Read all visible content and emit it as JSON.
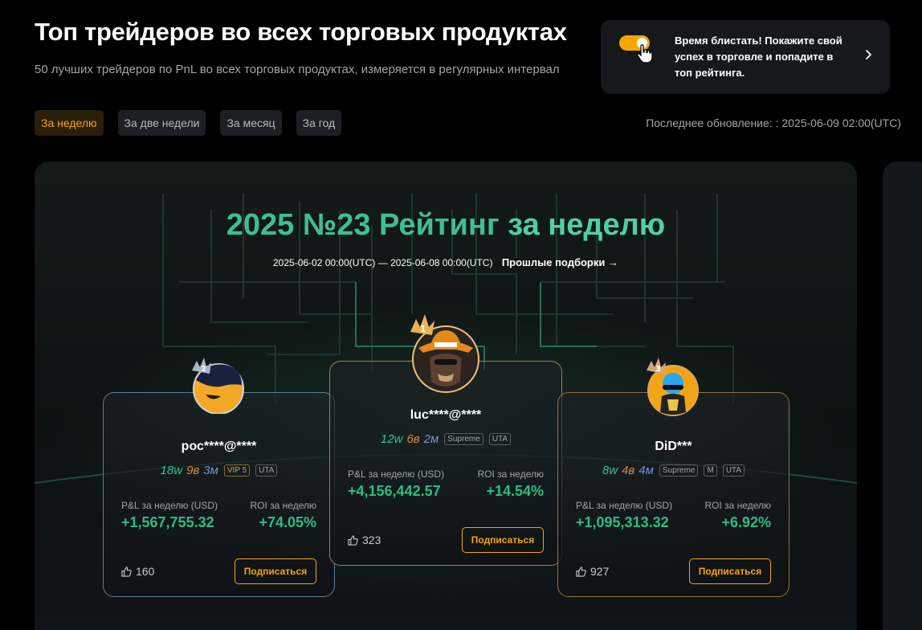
{
  "header": {
    "title": "Топ трейдеров во всех торговых продуктах",
    "subtitle": "50 лучших трейдеров по PnL во всех торговых продуктах, измеряется в регулярных интервал"
  },
  "promo": {
    "text": "Время блистать! Покажите свой успех в торговле и попадите в топ рейтинга."
  },
  "tabs": [
    {
      "label": "За неделю",
      "active": true
    },
    {
      "label": "За две недели",
      "active": false
    },
    {
      "label": "За месяц",
      "active": false
    },
    {
      "label": "За год",
      "active": false
    }
  ],
  "last_updated": "Последнее обновление: : 2025-06-09 02:00(UTC)",
  "ranking": {
    "title_green": "2025 №23 Рейтинг",
    "title_teal": " за неделю",
    "period": "2025-06-02 00:00(UTC) — 2025-06-08 00:00(UTC)",
    "past_link": "Прошлые подборки →"
  },
  "traders": {
    "rank1": {
      "rank": "1",
      "name": "luc****@****",
      "wins_w": "12w",
      "wins_b": "6в",
      "wins_m": "2м",
      "tag1": "Supreme",
      "tag2": "UTA",
      "pnl_label": "P&L за неделю (USD)",
      "pnl": "+4,156,442.57",
      "roi_label": "ROI за неделю",
      "roi": "+14.54%",
      "likes": "323",
      "follow": "Подписаться"
    },
    "rank2": {
      "rank": "2",
      "name": "рос****@****",
      "wins_w": "18w",
      "wins_b": "9в",
      "wins_m": "3м",
      "tag1": "VIP 5",
      "tag2": "UTA",
      "pnl_label": "P&L за неделю (USD)",
      "pnl": "+1,567,755.32",
      "roi_label": "ROI за неделю",
      "roi": "+74.05%",
      "likes": "160",
      "follow": "Подписаться"
    },
    "rank3": {
      "rank": "3",
      "name": "DiD***",
      "wins_w": "8w",
      "wins_b": "4в",
      "wins_m": "4м",
      "tag1": "Supreme",
      "tag2": "M",
      "tag3": "UTA",
      "pnl_label": "P&L за неделю (USD)",
      "pnl": "+1,095,313.32",
      "roi_label": "ROI за неделю",
      "roi": "+6.92%",
      "likes": "927",
      "follow": "Подписаться"
    }
  },
  "colors": {
    "accent": "#f7a600",
    "green": "#2dbd85",
    "teal": "#3ebf90"
  }
}
